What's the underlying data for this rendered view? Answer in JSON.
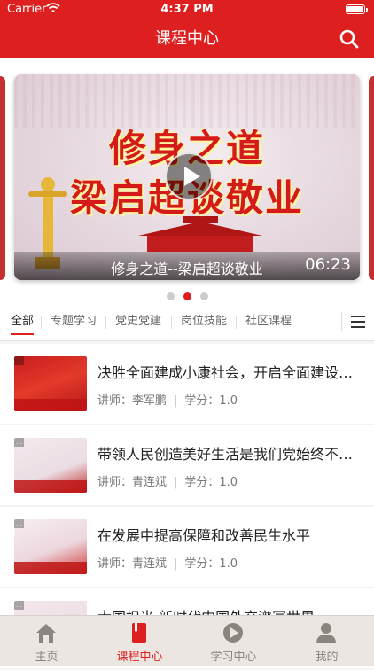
{
  "status": {
    "carrier": "Carrier",
    "time": "4:37 PM"
  },
  "header": {
    "title": "课程中心"
  },
  "banner": {
    "line1": "修身之道",
    "line2": "梁启超谈敬业",
    "caption": "修身之道--梁启超谈敬业",
    "duration": "06:23",
    "page_count": 3,
    "active_page": 1
  },
  "tabs": [
    {
      "label": "全部",
      "active": true
    },
    {
      "label": "专题学习",
      "active": false
    },
    {
      "label": "党史党建",
      "active": false
    },
    {
      "label": "岗位技能",
      "active": false
    },
    {
      "label": "社区课程",
      "active": false
    }
  ],
  "courses": [
    {
      "title": "决胜全面建成小康社会，开启全面建设社会主义现代化国家新征程",
      "teacher_label": "讲师：李军鹏",
      "credit_label": "学分：1.0"
    },
    {
      "title": "带领人民创造美好生活是我们党始终不渝的奋斗目标",
      "teacher_label": "讲师：青连斌",
      "credit_label": "学分：1.0"
    },
    {
      "title": "在发展中提高保障和改善民生水平",
      "teacher_label": "讲师：青连斌",
      "credit_label": "学分：1.0"
    },
    {
      "title": "大国担当 新时代中国外交谱写世界",
      "teacher_label": "",
      "credit_label": ""
    }
  ],
  "tabbar": [
    {
      "label": "主页",
      "icon": "home-icon",
      "active": false
    },
    {
      "label": "课程中心",
      "icon": "book-icon",
      "active": true
    },
    {
      "label": "学习中心",
      "icon": "play-circle-icon",
      "active": false
    },
    {
      "label": "我的",
      "icon": "person-icon",
      "active": false
    }
  ],
  "colors": {
    "brand": "#dd1f1f",
    "tabbar_bg": "#ebe6e1"
  }
}
